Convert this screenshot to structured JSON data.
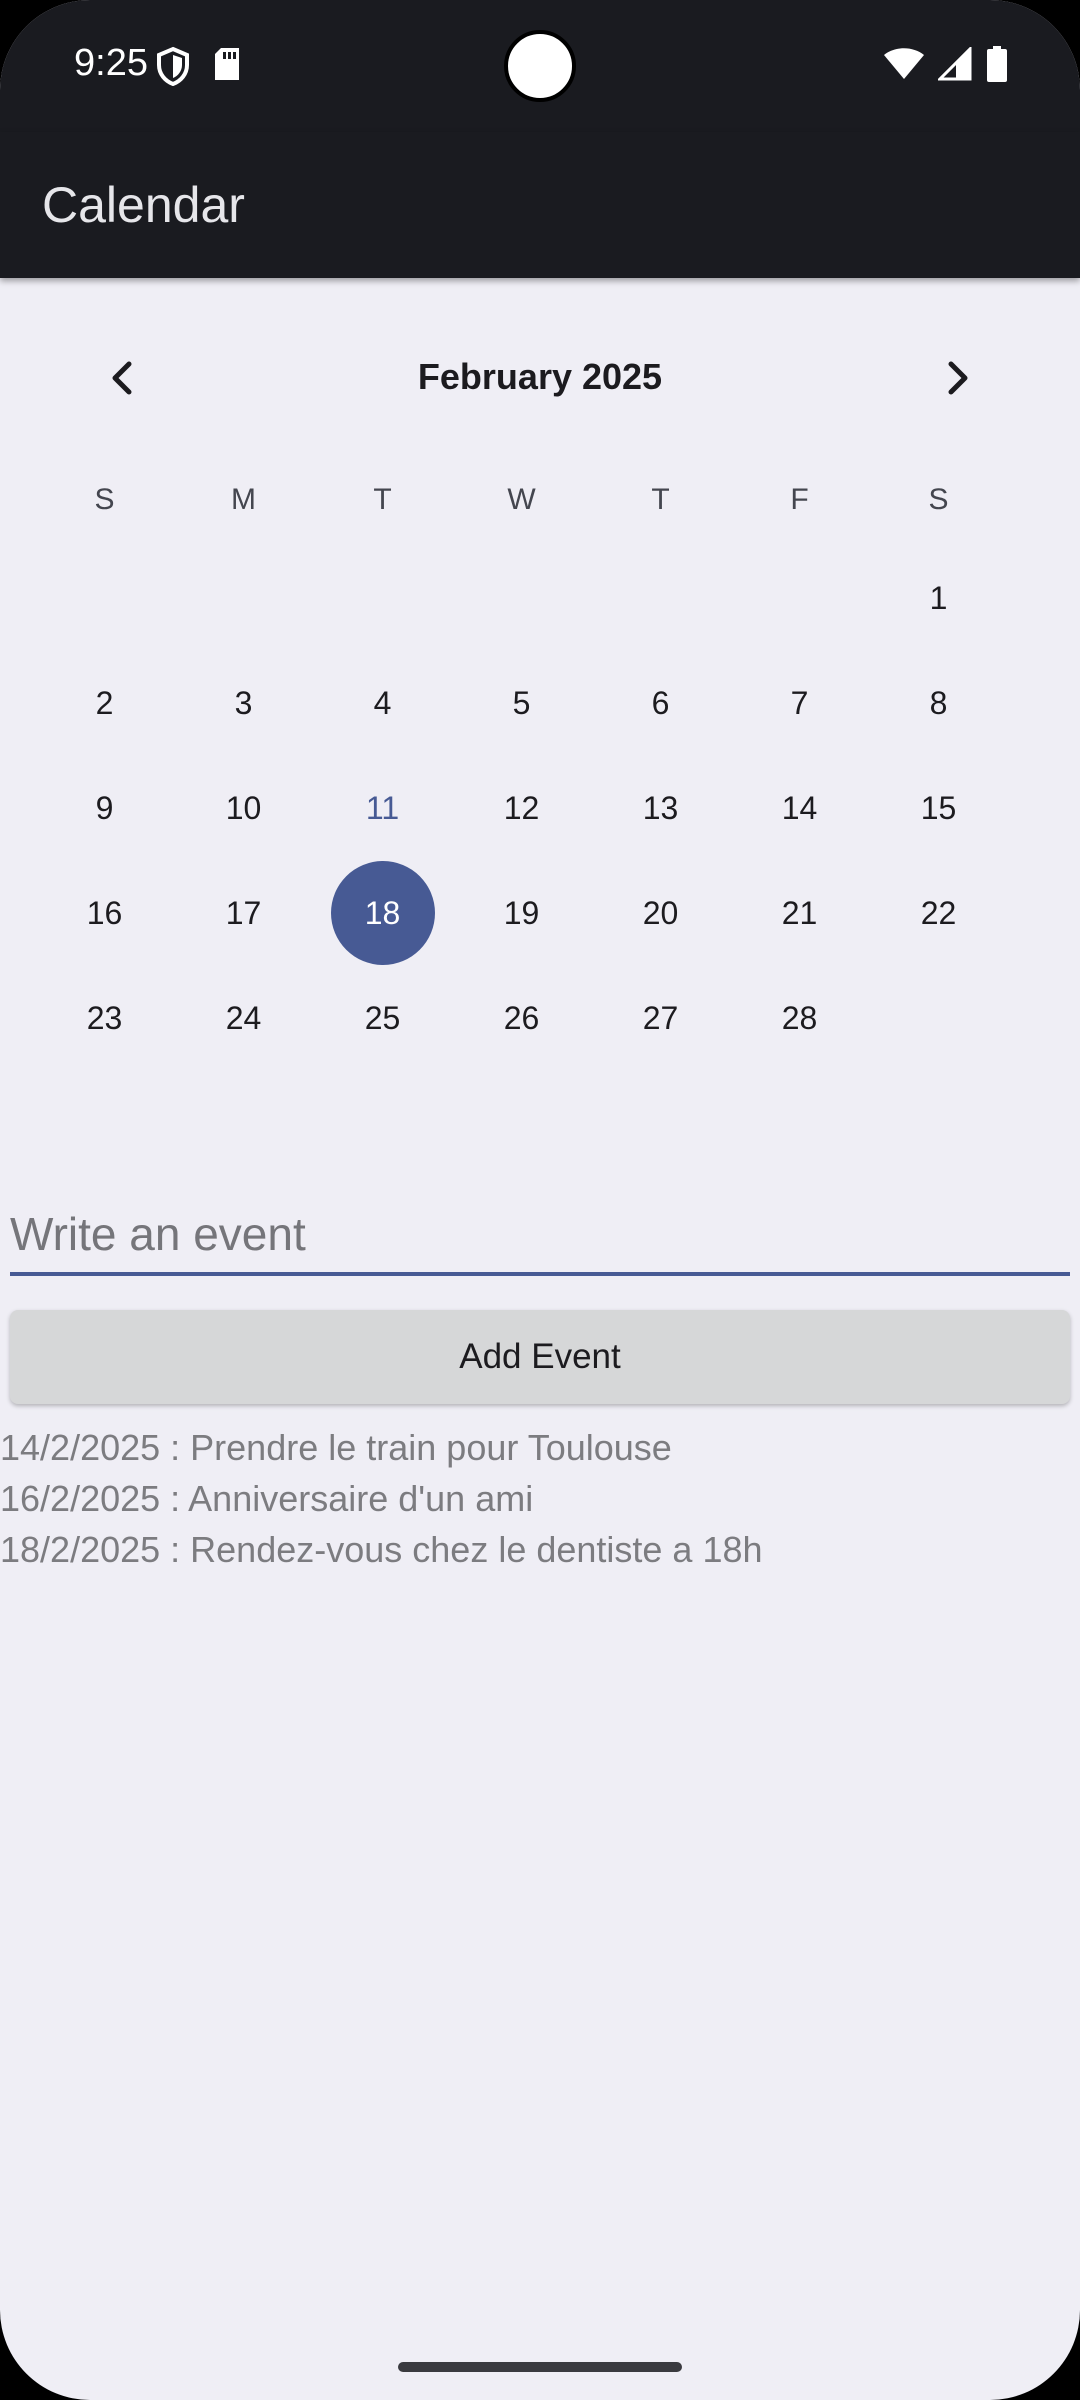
{
  "status_bar": {
    "time": "9:25",
    "icons": [
      "shield-icon",
      "sd-card-icon",
      "wifi-icon",
      "signal-icon",
      "battery-icon"
    ]
  },
  "app_bar": {
    "title": "Calendar"
  },
  "calendar": {
    "month_title": "February 2025",
    "prev_icon": "chevron-left-icon",
    "next_icon": "chevron-right-icon",
    "weekdays": [
      "S",
      "M",
      "T",
      "W",
      "T",
      "F",
      "S"
    ],
    "weeks": [
      [
        "",
        "",
        "",
        "",
        "",
        "",
        "1"
      ],
      [
        "2",
        "3",
        "4",
        "5",
        "6",
        "7",
        "8"
      ],
      [
        "9",
        "10",
        "11",
        "12",
        "13",
        "14",
        "15"
      ],
      [
        "16",
        "17",
        "18",
        "19",
        "20",
        "21",
        "22"
      ],
      [
        "23",
        "24",
        "25",
        "26",
        "27",
        "28",
        ""
      ]
    ],
    "today": "11",
    "selected": "18",
    "accent_color": "#475a94"
  },
  "event_input": {
    "placeholder": "Write an event",
    "value": ""
  },
  "add_button": {
    "label": "Add Event"
  },
  "events": [
    "14/2/2025 : Prendre le train pour Toulouse",
    "16/2/2025 : Anniversaire d'un ami",
    "18/2/2025 : Rendez-vous chez le dentiste a 18h"
  ]
}
